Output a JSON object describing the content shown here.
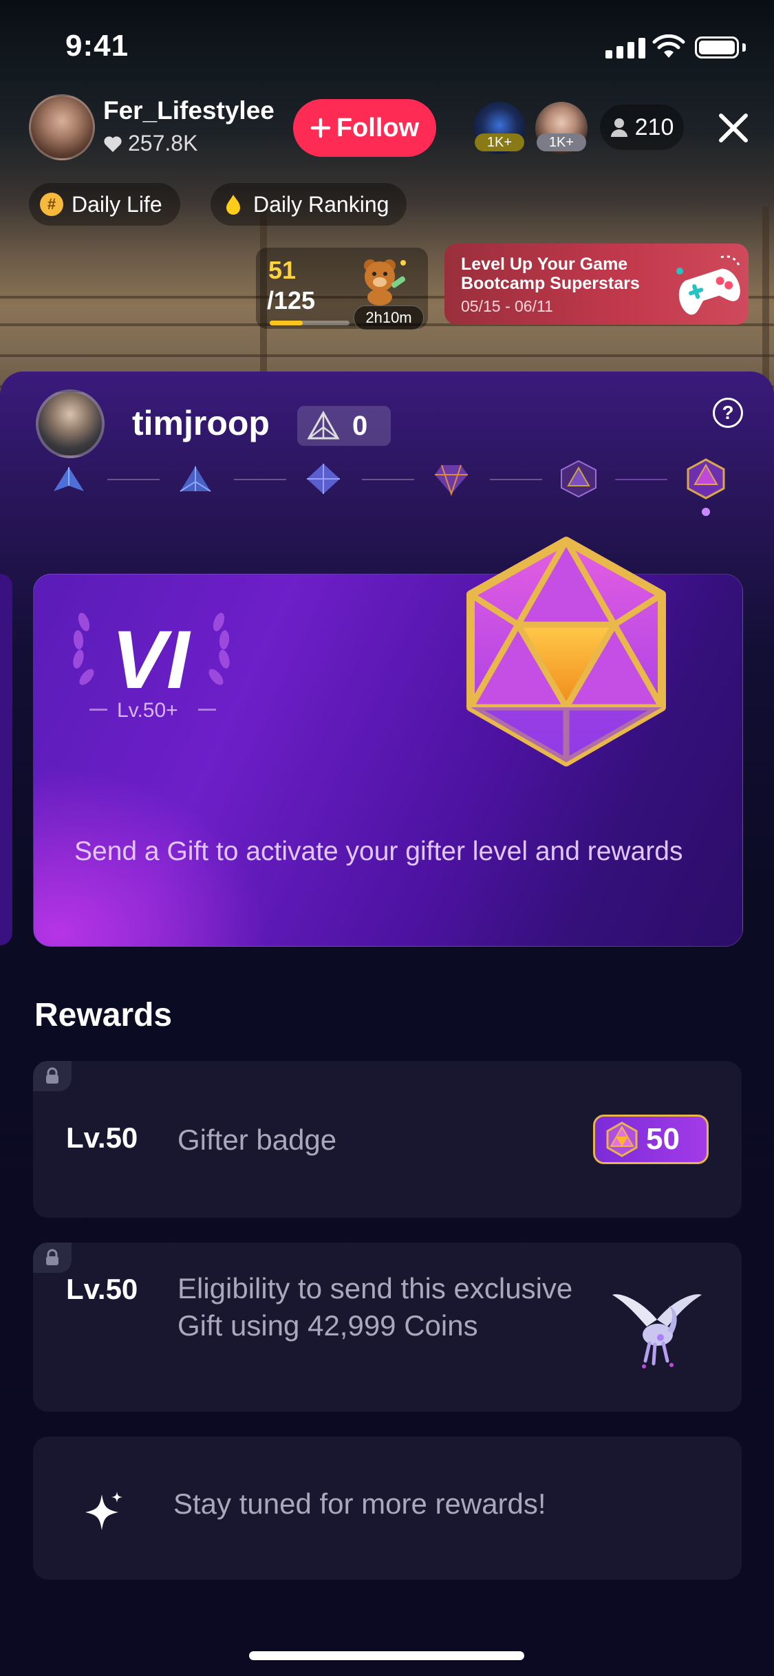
{
  "status_bar": {
    "time": "9:41",
    "icons": [
      "signal-icon",
      "wifi-icon",
      "battery-icon"
    ]
  },
  "host": {
    "name": "Fer_Lifestylee",
    "likes": "257.8K",
    "follow_label": "Follow",
    "viewers": [
      {
        "badge": "1K+",
        "badge_color": "#8a7a16"
      },
      {
        "badge": "1K+",
        "badge_color": "#7c7c88"
      }
    ],
    "viewer_count": "210"
  },
  "tags": [
    {
      "label": "Daily Life",
      "icon": "hashtag-icon",
      "color": "#f6b93b"
    },
    {
      "label": "Daily Ranking",
      "icon": "flame-icon",
      "color": "#ffcc1a"
    }
  ],
  "goal": {
    "current": "51",
    "total": "/125",
    "progress": 0.41,
    "time": "2h10m"
  },
  "event": {
    "line1": "Level Up Your Game",
    "line2": "Bootcamp Superstars",
    "dates": "05/15 - 06/11"
  },
  "user": {
    "name": "timjroop",
    "score": "0"
  },
  "level_card": {
    "roman": "VI",
    "level": "Lv.50+",
    "message": "Send a Gift to activate your gifter level and rewards"
  },
  "rewards": {
    "title": "Rewards",
    "items": [
      {
        "level": "Lv.50",
        "description": "Gifter badge",
        "badge_value": "50"
      },
      {
        "level": "Lv.50",
        "description": "Eligibility to send this exclusive Gift using 42,999 Coins"
      }
    ],
    "more": "Stay tuned for more rewards!"
  },
  "colors": {
    "accent": "#fe2c55",
    "gold": "#e6b64a",
    "panel": "#0c0b24"
  }
}
